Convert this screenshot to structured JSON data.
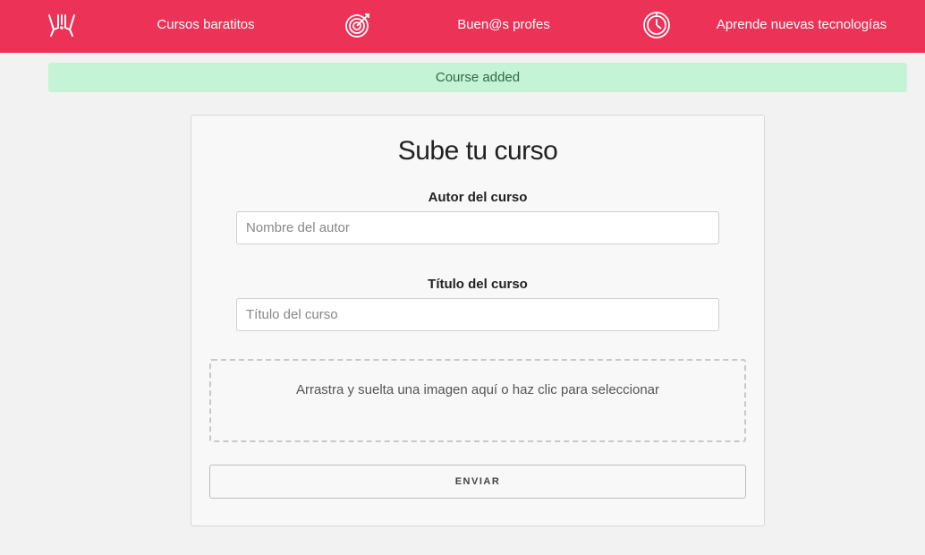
{
  "navbar": {
    "background": "#ec3257",
    "items": [
      {
        "icon": "glasses-cheers-icon"
      },
      {
        "label": "Cursos baratitos"
      },
      {
        "icon": "target-icon"
      },
      {
        "label": "Buen@s profes"
      },
      {
        "icon": "clock-icon"
      },
      {
        "label": "Aprende nuevas tecnologías"
      }
    ]
  },
  "alert": {
    "message": "Course added",
    "color": "#c5f3d5"
  },
  "form": {
    "title": "Sube tu curso",
    "author_label": "Autor del curso",
    "author_placeholder": "Nombre del autor",
    "author_value": "",
    "course_title_label": "Título del curso",
    "course_title_placeholder": "Título del curso",
    "course_title_value": "",
    "dropzone_text": "Arrastra y suelta una imagen aquí o haz clic para seleccionar",
    "submit_label": "ENVIAR"
  }
}
